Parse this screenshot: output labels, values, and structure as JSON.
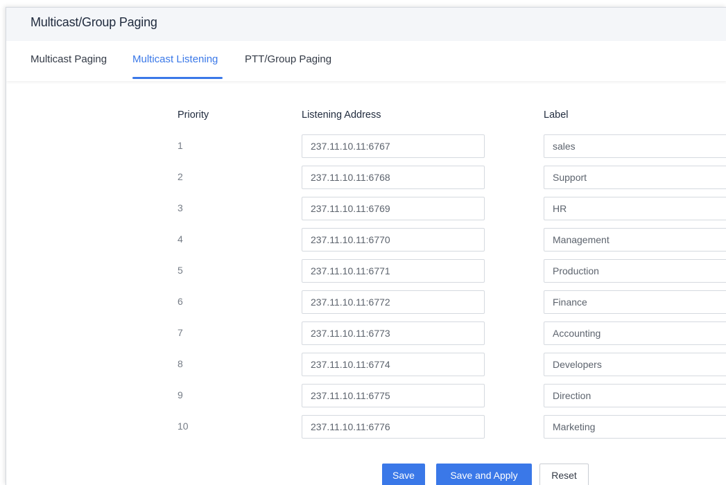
{
  "header": {
    "title": "Multicast/Group Paging"
  },
  "tabs": [
    {
      "label": "Multicast Paging",
      "active": false
    },
    {
      "label": "Multicast Listening",
      "active": true
    },
    {
      "label": "PTT/Group Paging",
      "active": false
    }
  ],
  "table": {
    "columns": [
      "Priority",
      "Listening Address",
      "Label"
    ],
    "rows": [
      {
        "priority": "1",
        "address": "237.11.10.11:6767",
        "label": "sales"
      },
      {
        "priority": "2",
        "address": "237.11.10.11:6768",
        "label": "Support"
      },
      {
        "priority": "3",
        "address": "237.11.10.11:6769",
        "label": "HR"
      },
      {
        "priority": "4",
        "address": "237.11.10.11:6770",
        "label": "Management"
      },
      {
        "priority": "5",
        "address": "237.11.10.11:6771",
        "label": "Production"
      },
      {
        "priority": "6",
        "address": "237.11.10.11:6772",
        "label": "Finance"
      },
      {
        "priority": "7",
        "address": "237.11.10.11:6773",
        "label": "Accounting"
      },
      {
        "priority": "8",
        "address": "237.11.10.11:6774",
        "label": "Developers"
      },
      {
        "priority": "9",
        "address": "237.11.10.11:6775",
        "label": "Direction"
      },
      {
        "priority": "10",
        "address": "237.11.10.11:6776",
        "label": "Marketing"
      }
    ]
  },
  "actions": {
    "save": "Save",
    "save_apply": "Save and Apply",
    "reset": "Reset"
  },
  "colors": {
    "accent": "#3a78e8",
    "header_bg": "#f4f6f9"
  }
}
